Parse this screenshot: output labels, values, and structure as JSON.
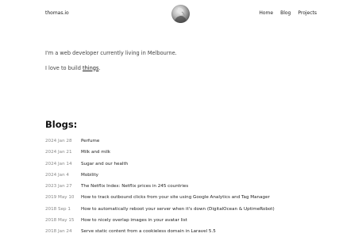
{
  "header": {
    "site_name": "thomas.io",
    "nav": [
      {
        "label": "Home"
      },
      {
        "label": "Blog"
      },
      {
        "label": "Projects"
      }
    ]
  },
  "intro": {
    "line1": "I'm a web developer currently living in Melbourne.",
    "line2_prefix": "I love to build ",
    "line2_link": "things",
    "line2_suffix": "."
  },
  "blogs": {
    "heading": "Blogs:",
    "posts": [
      {
        "date": "2024 Jan 28",
        "title": "Perfume"
      },
      {
        "date": "2024 Jan 21",
        "title": "Milk and milk"
      },
      {
        "date": "2024 Jan 14",
        "title": "Sugar and our health"
      },
      {
        "date": "2024 Jan 4",
        "title": "Mobility"
      },
      {
        "date": "2023 Jan 27",
        "title": "The Netflix Index: Netflix prices in 245 countries"
      },
      {
        "date": "2019 May 10",
        "title": "How to track outbound clicks from your site using Google Analytics and Tag Manager"
      },
      {
        "date": "2018 Sep 1",
        "title": "How to automatically reboot your server when it's down (DigitalOcean & UptimeRobot)"
      },
      {
        "date": "2018 May 15",
        "title": "How to nicely overlap images in your avatar list"
      },
      {
        "date": "2018 Jan 24",
        "title": "Serve static content from a cookieless domain in Laravel 5.5"
      }
    ]
  }
}
